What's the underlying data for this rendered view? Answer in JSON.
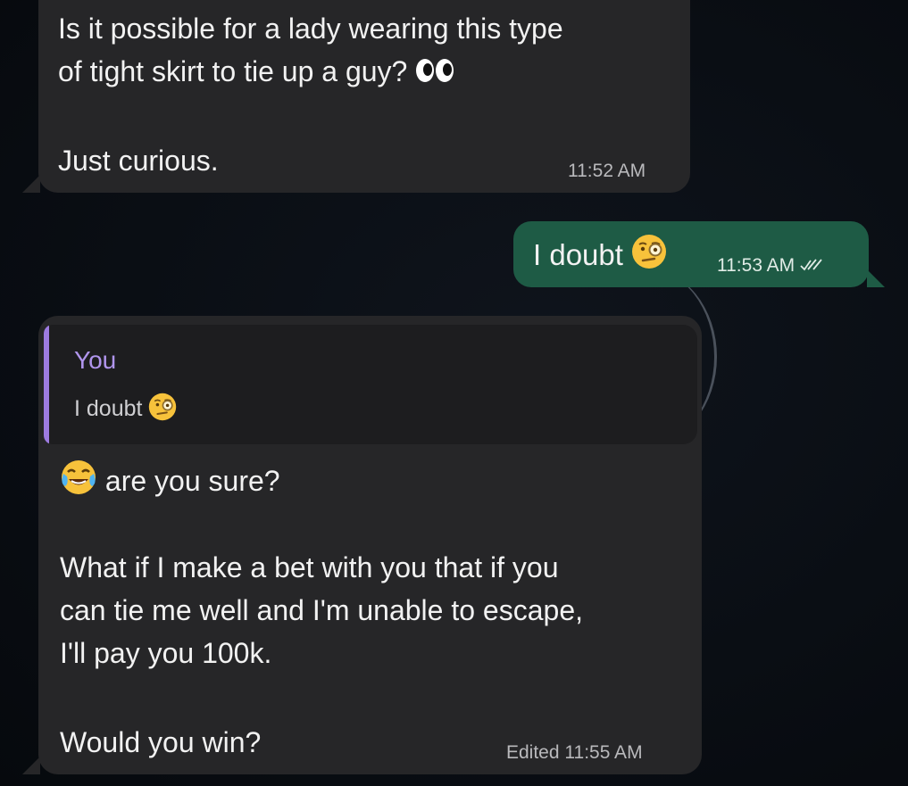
{
  "messages": [
    {
      "direction": "incoming",
      "line1": "Is it possible for a lady wearing this type\nof tight skirt to tie up a guy?",
      "line1_emoji": "eyes-emoji",
      "line2": "Just curious.",
      "time": "11:52 AM"
    },
    {
      "direction": "outgoing",
      "text": "I doubt",
      "emoji": "face-with-monocle-emoji",
      "time": "11:53 AM",
      "status_icon": "double-check-icon"
    },
    {
      "direction": "incoming",
      "reply": {
        "author": "You",
        "text": "I doubt",
        "emoji": "face-with-monocle-emoji"
      },
      "line1_emoji": "face-with-tears-of-joy-emoji",
      "line1": "are you sure?",
      "para2": "What if I make a bet with you that if you\ncan tie me well and I'm unable to escape,\nI'll pay you 100k.",
      "para3": "Would you win?",
      "edited_label": "Edited",
      "time": "11:55 AM"
    }
  ],
  "colors": {
    "background": "#0a0e14",
    "incoming_bubble": "#262628",
    "outgoing_bubble": "#1e5b45",
    "reply_accent": "#9d7be0"
  }
}
